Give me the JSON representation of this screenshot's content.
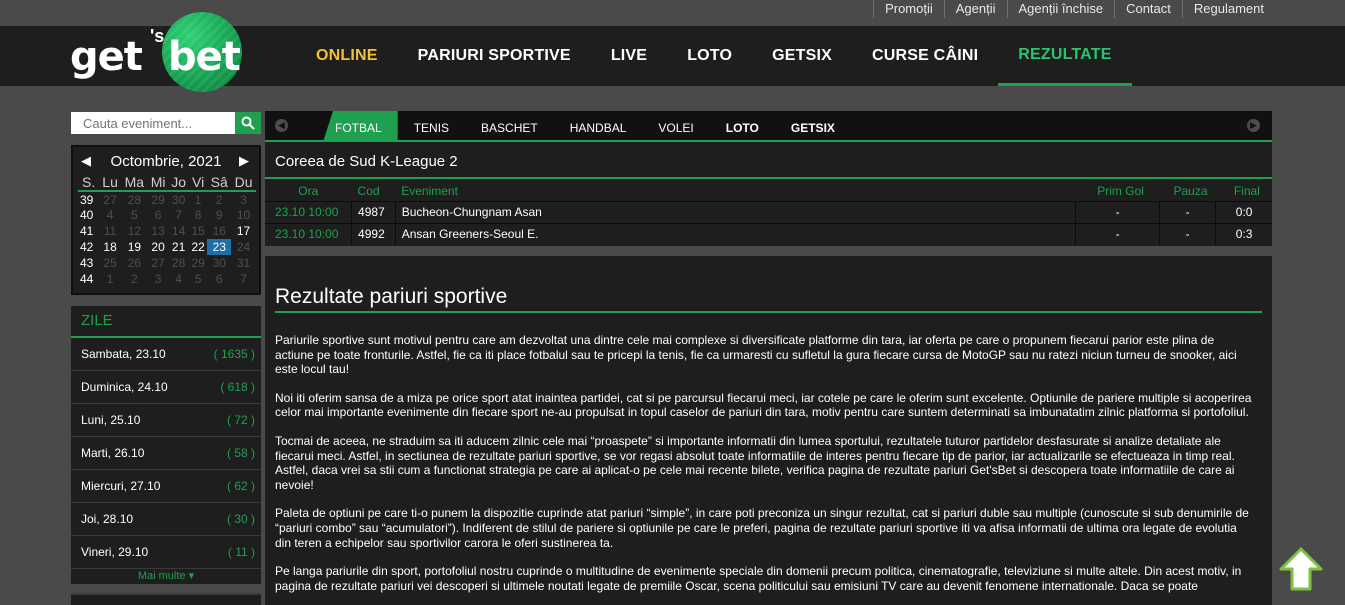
{
  "toplinks": [
    "Promoții",
    "Agenții",
    "Agenții închise",
    "Contact",
    "Regulament"
  ],
  "logo": {
    "text_left": "get",
    "apostrophe": "'s",
    "text_right": "bet"
  },
  "mainnav": [
    "ONLINE",
    "PARIURI SPORTIVE",
    "LIVE",
    "LOTO",
    "GETSIX",
    "CURSE CÂINI",
    "REZULTATE"
  ],
  "search": {
    "placeholder": "Cauta eveniment..."
  },
  "calendar": {
    "month": "Octombrie, 2021",
    "prev": "◀",
    "next": "▶",
    "weekdays": [
      "S.",
      "Lu",
      "Ma",
      "Mi",
      "Jo",
      "Vi",
      "Sâ",
      "Du"
    ],
    "weeks": [
      {
        "wk": "39",
        "days": [
          "27",
          "28",
          "29",
          "30",
          "1",
          "2",
          "3"
        ],
        "cur": [
          false,
          false,
          false,
          false,
          false,
          false,
          false
        ]
      },
      {
        "wk": "40",
        "days": [
          "4",
          "5",
          "6",
          "7",
          "8",
          "9",
          "10"
        ],
        "cur": [
          false,
          false,
          false,
          false,
          false,
          false,
          false
        ]
      },
      {
        "wk": "41",
        "days": [
          "11",
          "12",
          "13",
          "14",
          "15",
          "16",
          "17"
        ],
        "cur": [
          false,
          false,
          false,
          false,
          false,
          false,
          true
        ]
      },
      {
        "wk": "42",
        "days": [
          "18",
          "19",
          "20",
          "21",
          "22",
          "23",
          "24"
        ],
        "cur": [
          true,
          true,
          true,
          true,
          true,
          true,
          false
        ]
      },
      {
        "wk": "43",
        "days": [
          "25",
          "26",
          "27",
          "28",
          "29",
          "30",
          "31"
        ],
        "cur": [
          false,
          false,
          false,
          false,
          false,
          false,
          false
        ]
      },
      {
        "wk": "44",
        "days": [
          "1",
          "2",
          "3",
          "4",
          "5",
          "6",
          "7"
        ],
        "cur": [
          false,
          false,
          false,
          false,
          false,
          false,
          false
        ]
      }
    ],
    "selected_day": "23"
  },
  "zile": {
    "title": "ZILE",
    "items": [
      {
        "label": "Sambata, 23.10",
        "count": "( 1635 )"
      },
      {
        "label": "Duminica, 24.10",
        "count": "( 618 )"
      },
      {
        "label": "Luni, 25.10",
        "count": "( 72 )"
      },
      {
        "label": "Marti, 26.10",
        "count": "( 58 )"
      },
      {
        "label": "Miercuri, 27.10",
        "count": "( 62 )"
      },
      {
        "label": "Joi, 28.10",
        "count": "( 30 )"
      },
      {
        "label": "Vineri, 29.10",
        "count": "( 11 )"
      }
    ],
    "more": "Mai multe ▾"
  },
  "sport_tabs": [
    {
      "label": "FOTBAL",
      "active": true,
      "bold": false
    },
    {
      "label": "TENIS",
      "active": false,
      "bold": false
    },
    {
      "label": "BASCHET",
      "active": false,
      "bold": false
    },
    {
      "label": "HANDBAL",
      "active": false,
      "bold": false
    },
    {
      "label": "VOLEI",
      "active": false,
      "bold": false
    },
    {
      "label": "LOTO",
      "active": false,
      "bold": true
    },
    {
      "label": "GETSIX",
      "active": false,
      "bold": true
    }
  ],
  "league": "Coreea de Sud K-League 2",
  "table": {
    "headers": [
      "Ora",
      "Cod",
      "Eveniment",
      "Prim Gol",
      "Pauza",
      "Final"
    ],
    "rows": [
      [
        "23.10 10:00",
        "4987",
        "Bucheon-Chungnam Asan",
        "-",
        "-",
        "0:0"
      ],
      [
        "23.10 10:00",
        "4992",
        "Ansan Greeners-Seoul E.",
        "-",
        "-",
        "0:3"
      ]
    ]
  },
  "content": {
    "title": "Rezultate pariuri sportive",
    "paragraphs": [
      "Pariurile sportive sunt motivul pentru care am dezvoltat una dintre cele mai complexe si diversificate platforme din tara, iar oferta pe care o propunem fiecarui parior este plina de actiune pe toate fronturile. Astfel, fie ca iti place fotbalul sau te pricepi la tenis, fie ca urmaresti cu sufletul la gura fiecare cursa de MotoGP sau nu ratezi niciun turneu de snooker, aici este locul tau!",
      "Noi iti oferim sansa de a miza pe orice sport atat inaintea partidei, cat si pe parcursul fiecarui meci, iar cotele pe care le oferim sunt excelente. Optiunile de pariere multiple si acoperirea celor mai importante evenimente din fiecare sport ne-au propulsat in topul caselor de pariuri din tara, motiv pentru care suntem determinati sa imbunatatim zilnic platforma si portofoliul.",
      "Tocmai de aceea, ne straduim sa iti aducem zilnic cele mai “proaspete” si importante informatii din lumea sportului, rezultatele tuturor partidelor desfasurate si analize detaliate ale fiecarui meci. Astfel, in sectiunea de rezultate pariuri sportive, se vor regasi absolut toate informatiile de interes pentru fiecare tip de parior, iar actualizarile se efectueaza in timp real. Astfel, daca vrei sa stii cum a functionat strategia pe care ai aplicat-o pe cele mai recente bilete, verifica pagina de rezultate pariuri Get'sBet si descopera toate informatiile de care ai nevoie!",
      "Paleta de optiuni pe care ti-o punem la dispozitie cuprinde atat pariuri “simple”, in care poti preconiza un singur rezultat, cat si pariuri duble sau multiple (cunoscute si sub denumirile de “pariuri combo” sau “acumulatori”). Indiferent de stilul de pariere si optiunile pe care le preferi, pagina de rezultate pariuri sportive iti va afisa informatii de ultima ora legate de evolutia din teren a echipelor sau sportivilor carora le oferi sustinerea ta.",
      "Pe langa pariurile din sport, portofoliul nostru cuprinde o multitudine de evenimente speciale din domenii precum politica, cinematografie, televiziune si multe altele. Din acest motiv, in pagina de rezultate pariuri vei descoperi si ultimele noutati legate de premiile Oscar, scena politicului sau emisiuni TV care au devenit fenomene internationale. Daca se poate"
    ]
  },
  "colors": {
    "accent": "#1fa04e",
    "online": "#f2c234",
    "selected_day": "#1d6fa6",
    "panel": "#1e1e1e",
    "bg": "#4a4a4a"
  }
}
